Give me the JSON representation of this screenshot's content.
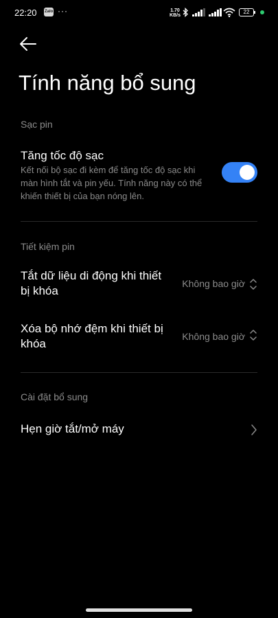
{
  "status_bar": {
    "time": "22:20",
    "app_icon_label": "Zalo",
    "more": "···",
    "net_speed_value": "1.70",
    "net_speed_unit": "KB/s",
    "battery": "22",
    "icons": [
      "zalo-icon",
      "more-icon",
      "bluetooth-icon",
      "signal-icon",
      "signal-icon",
      "wifi-icon",
      "battery-icon",
      "charging-dot-icon"
    ]
  },
  "header": {
    "back_icon": "back-arrow-icon",
    "title": "Tính năng bổ sung"
  },
  "sections": {
    "charging": {
      "header": "Sạc pin",
      "fast_charge": {
        "title": "Tăng tốc độ sạc",
        "description": "Kết nối bộ sạc đi kèm để tăng tốc độ sạc khi màn hình tắt và pin yếu. Tính năng này có thể khiến thiết bị của bạn nóng lên.",
        "toggle_on": true
      }
    },
    "battery_saver": {
      "header": "Tiết kiệm pin",
      "items": [
        {
          "title_line1": "Tắt dữ liệu di động khi thiết",
          "title_line2": "bị khóa",
          "value": "Không bao giờ"
        },
        {
          "title_line1": "Xóa bộ nhớ đệm khi thiết bị",
          "title_line2": "khóa",
          "value": "Không bao giờ"
        }
      ]
    },
    "additional": {
      "header": "Cài đặt bổ sung",
      "items": [
        {
          "title": "Hẹn giờ tắt/mở máy"
        }
      ]
    }
  },
  "colors": {
    "background": "#000000",
    "accent": "#3482f6",
    "secondary_text": "#8c8c8c",
    "divider": "#2a2a2a",
    "charging_dot": "#2ecc71"
  }
}
